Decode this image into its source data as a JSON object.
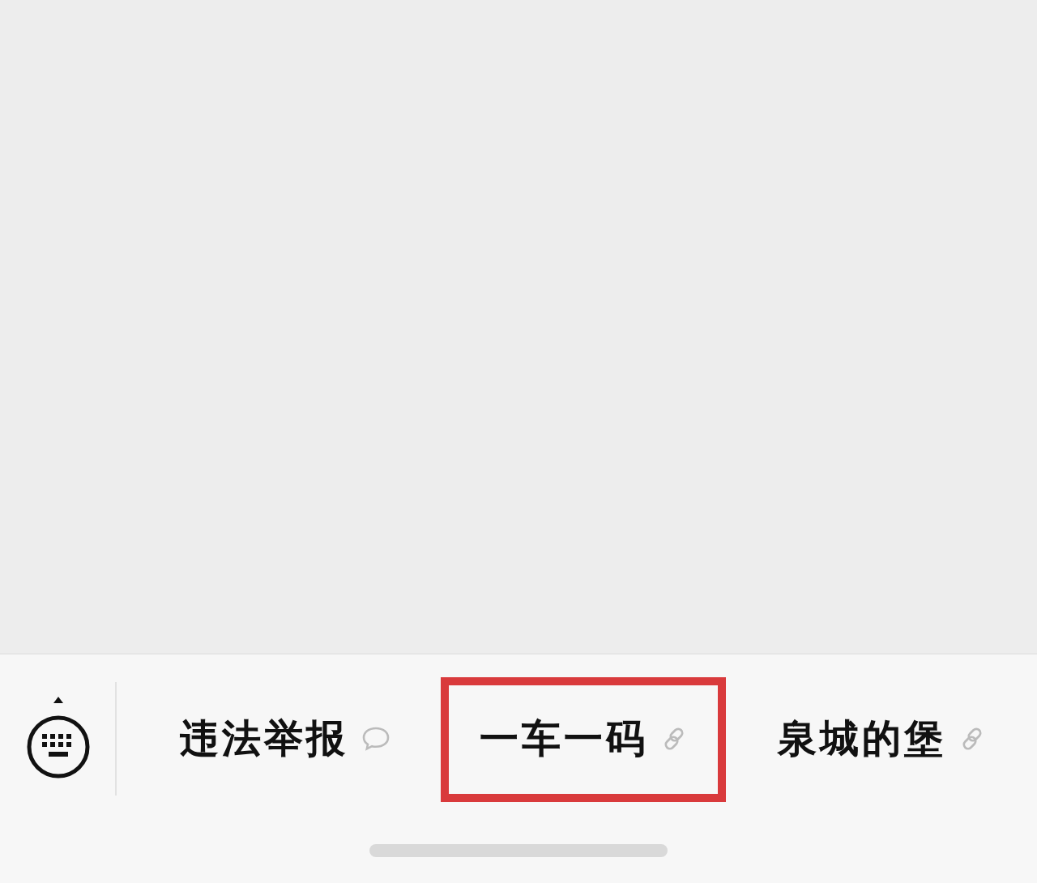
{
  "menu_items": [
    {
      "label": "违法举报",
      "kind": "message",
      "highlighted": false
    },
    {
      "label": "一车一码",
      "kind": "link",
      "highlighted": true
    },
    {
      "label": "泉城的堡",
      "kind": "link",
      "highlighted": false
    }
  ]
}
